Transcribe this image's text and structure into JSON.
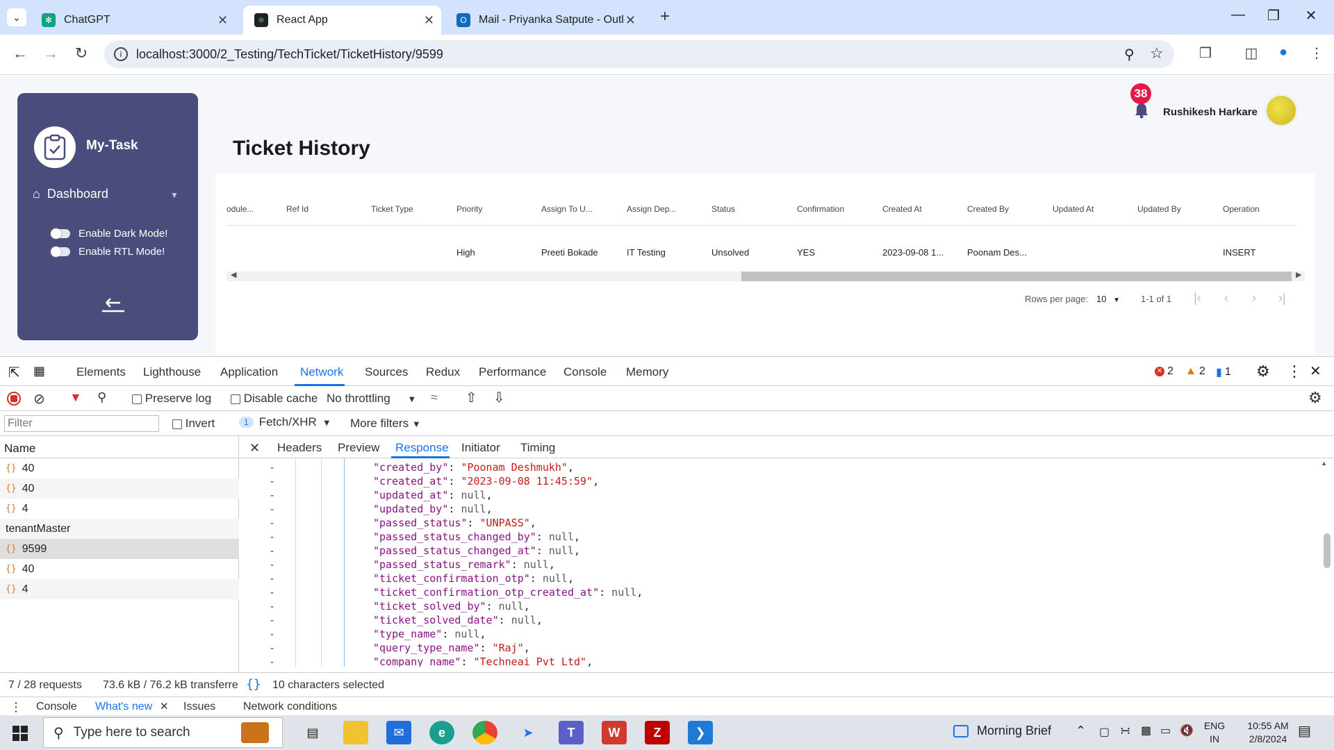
{
  "browser": {
    "tabs": [
      {
        "title": "ChatGPT"
      },
      {
        "title": "React App"
      },
      {
        "title": "Mail - Priyanka Satpute - Outlo"
      }
    ],
    "new_tab": "+",
    "url": "localhost:3000/2_Testing/TechTicket/TicketHistory/9599"
  },
  "app": {
    "brand": "My-Task",
    "menu": {
      "dashboard": "Dashboard"
    },
    "toggles": {
      "dark": "Enable Dark Mode!",
      "rtl": "Enable RTL Mode!"
    },
    "notification_count": "38",
    "user_name": "Rushikesh Harkare",
    "page_title": "Ticket History",
    "table": {
      "columns": [
        "odule...",
        "Ref Id",
        "Ticket Type",
        "Priority",
        "Assign To U...",
        "Assign Dep...",
        "Status",
        "Confirmation",
        "Created At",
        "Created By",
        "Updated At",
        "Updated By",
        "Operation"
      ],
      "rows": [
        [
          "",
          "",
          "",
          "High",
          "Preeti Bokade",
          "IT Testing",
          "Unsolved",
          "YES",
          "2023-09-08 1...",
          "Poonam Des...",
          "",
          "",
          "INSERT"
        ]
      ]
    },
    "pagination": {
      "rows_per_page_label": "Rows per page:",
      "rows_per_page": "10",
      "range": "1-1 of 1"
    }
  },
  "devtools": {
    "tabs": [
      "Elements",
      "Lighthouse",
      "Application",
      "Network",
      "Sources",
      "Redux",
      "Performance",
      "Console",
      "Memory"
    ],
    "selected_tab": "Network",
    "counts": {
      "errors": "2",
      "warnings": "2",
      "info": "1"
    },
    "network": {
      "preserve_log": "Preserve log",
      "disable_cache": "Disable cache",
      "throttling": "No throttling",
      "filter_placeholder": "Filter",
      "invert": "Invert",
      "type_count": "1",
      "type_filter": "Fetch/XHR",
      "more_filters": "More filters"
    },
    "name_header": "Name",
    "requests": [
      {
        "name": "40",
        "icon": true
      },
      {
        "name": "40",
        "icon": true
      },
      {
        "name": "4",
        "icon": true
      },
      {
        "name": "tenantMaster",
        "icon": false
      },
      {
        "name": "9599",
        "icon": true,
        "selected": true
      },
      {
        "name": "40",
        "icon": true
      },
      {
        "name": "4",
        "icon": true
      }
    ],
    "detail_tabs": [
      "Headers",
      "Preview",
      "Response",
      "Initiator",
      "Timing"
    ],
    "selected_detail_tab": "Response",
    "response_lines": [
      {
        "key": "\"created_by\"",
        "value": "\"Poonam Deshmukh\"",
        "kind": "str"
      },
      {
        "key": "\"created_at\"",
        "value": "\"2023-09-08 11:45:59\"",
        "kind": "str"
      },
      {
        "key": "\"updated_at\"",
        "value": "null",
        "kind": "nul"
      },
      {
        "key": "\"updated_by\"",
        "value": "null",
        "kind": "nul"
      },
      {
        "key": "\"passed_status\"",
        "value": "\"UNPASS\"",
        "kind": "str"
      },
      {
        "key": "\"passed_status_changed_by\"",
        "value": "null",
        "kind": "nul"
      },
      {
        "key": "\"passed_status_changed_at\"",
        "value": "null",
        "kind": "nul"
      },
      {
        "key": "\"passed_status_remark\"",
        "value": "null",
        "kind": "nul"
      },
      {
        "key": "\"ticket_confirmation_otp\"",
        "value": "null",
        "kind": "nul"
      },
      {
        "key": "\"ticket_confirmation_otp_created_at\"",
        "value": "null",
        "kind": "nul"
      },
      {
        "key": "\"ticket_solved_by\"",
        "value": "null",
        "kind": "nul"
      },
      {
        "key": "\"ticket_solved_date\"",
        "value": "null",
        "kind": "nul"
      },
      {
        "key": "\"type_name\"",
        "value": "null",
        "kind": "nul"
      },
      {
        "key": "\"query_type_name\"",
        "value": "\"Raj\"",
        "kind": "str"
      },
      {
        "key": "\"company_name\"",
        "value": "\"Techneai Pvt Ltd\"",
        "kind": "str"
      }
    ],
    "status": {
      "requests": "7 / 28 requests",
      "transferred": "73.6 kB / 76.2 kB transferre",
      "selection": "10 characters selected"
    },
    "drawer_tabs": [
      "Console",
      "What's new",
      "Issues",
      "Network conditions"
    ],
    "selected_drawer_tab": "What's new"
  },
  "taskbar": {
    "search_placeholder": "Type here to search",
    "widget": "Morning Brief",
    "lang1": "ENG",
    "lang2": "IN",
    "time": "10:55 AM",
    "date": "2/8/2024"
  }
}
